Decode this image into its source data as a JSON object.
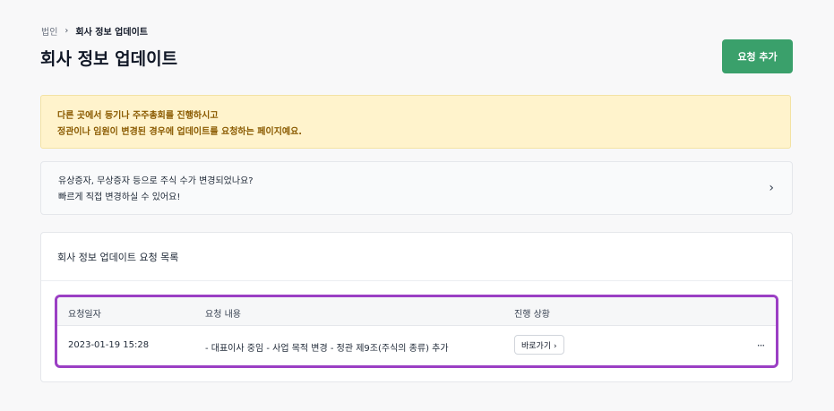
{
  "breadcrumb": {
    "parent": "법인",
    "separator": "›",
    "current": "회사 정보 업데이트"
  },
  "page": {
    "title": "회사 정보 업데이트",
    "add_button": "요청 추가"
  },
  "notice": {
    "line1": "다른 곳에서 등기나 주주총회를 진행하시고",
    "line2": "정관이나 임원이 변경된 경우에 업데이트를 요청하는 페이지예요."
  },
  "link_card": {
    "line1": "유상증자, 무상증자 등으로 주식 수가 변경되었나요?",
    "line2": "빠르게 직접 변경하실 수 있어요!",
    "chevron": "›"
  },
  "list": {
    "title": "회사 정보 업데이트 요청 목록",
    "columns": {
      "date": "요청일자",
      "content": "요청 내용",
      "status": "진행 상황"
    },
    "rows": [
      {
        "date": "2023-01-19 15:28",
        "content": "- 대표이사 중임 - 사업 목적 변경 - 정관 제9조(주식의 종류) 추가",
        "status_button": "바로가기 ›",
        "more": "···"
      }
    ]
  },
  "colors": {
    "accent": "#3aa06b",
    "notice_bg": "#fff3cc",
    "highlight": "#9b3fc4"
  }
}
